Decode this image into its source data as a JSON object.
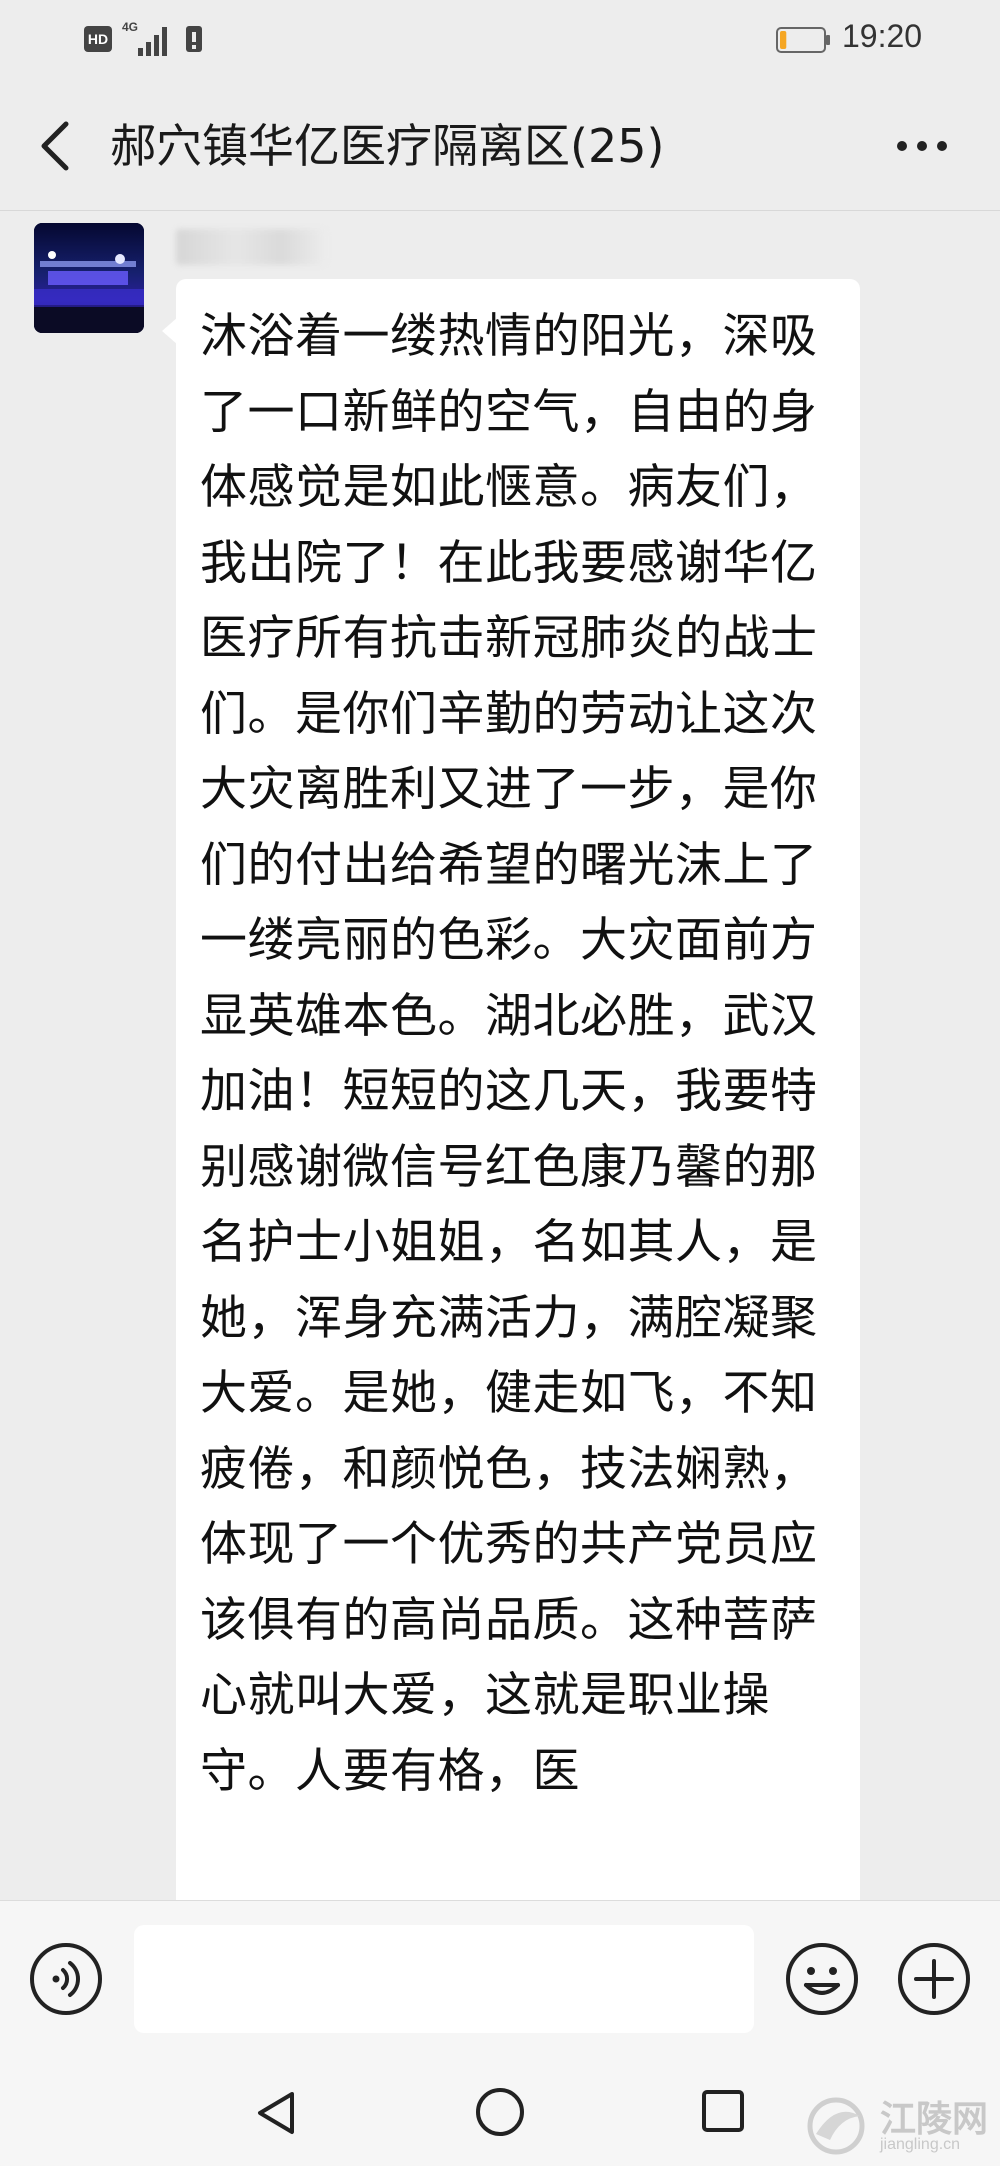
{
  "status_bar": {
    "hd_badge": "HD",
    "network_type": "4G",
    "time": "19:20",
    "battery_level": 0.15,
    "icons": [
      "signal-icon",
      "sim-icon",
      "battery-icon"
    ]
  },
  "header": {
    "title": "郝穴镇华亿医疗隔离区(25)",
    "back_icon": "chevron-left-icon",
    "more_icon": "more-dots-icon"
  },
  "message": {
    "text": "沐浴着一缕热情的阳光，深吸了一口新鲜的空气，自由的身体感觉是如此惬意。病友们，我出院了！在此我要感谢华亿医疗所有抗击新冠肺炎的战士们。是你们辛勤的劳动让这次大灾离胜利又进了一步，是你们的付出给希望的曙光沫上了一缕亮丽的色彩。大灾面前方显英雄本色。湖北必胜，武汉加油！短短的这几天，我要特别感谢微信号红色康乃馨的那名护士小姐姐，名如其人，是她，浑身充满活力，满腔凝聚大爱。是她，健走如飞，不知疲倦，和颜悦色，技法娴熟，体现了一个优秀的共产党员应该俱有的高尚品质。这种菩萨心就叫大爱，这就是职业操守。人要有格，医"
  },
  "input_bar": {
    "placeholder": "",
    "icons": [
      "voice-icon",
      "emoji-icon",
      "plus-icon"
    ]
  },
  "system_nav": {
    "icons": [
      "nav-back-icon",
      "nav-home-icon",
      "nav-recents-icon"
    ]
  },
  "watermark": {
    "name": "江陵网",
    "url": "jiangling.cn"
  },
  "colors": {
    "background": "#ededed",
    "bubble": "#ffffff",
    "text": "#111111",
    "battery_low": "#f5a623"
  }
}
